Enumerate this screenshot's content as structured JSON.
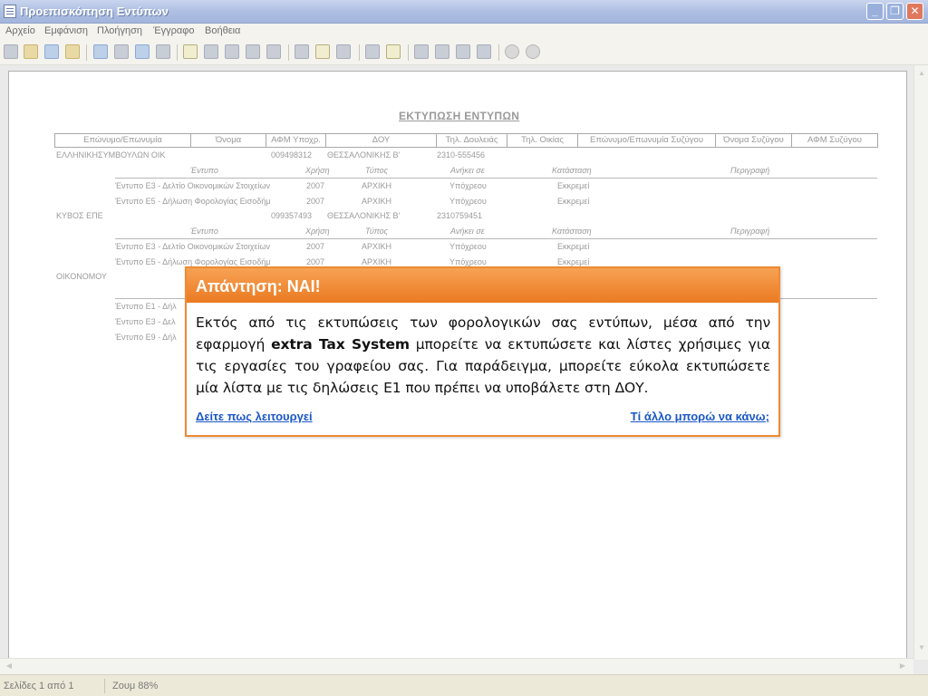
{
  "window": {
    "title": "Προεπισκόπηση Εντύπων"
  },
  "menu": [
    "Αρχείο",
    "Εμφάνιση",
    "Πλοήγηση",
    "Έγγραφο",
    "Βοήθεια"
  ],
  "report": {
    "title": "ΕΚΤΥΠΩΣΗ ΕΝΤΥΠΩΝ",
    "columns": [
      "Επώνυμο/Επωνυμία",
      "Όνομα",
      "ΑΦΜ Υποχρ.",
      "ΔΟΥ",
      "Τηλ. Δουλειάς",
      "Τηλ. Οικίας",
      "Επώνυμο/Επωνυμία Συζύγου",
      "Όνομα Συζύγου",
      "ΑΦΜ Συζύγου"
    ],
    "sub_columns": [
      "Έντυπο",
      "Χρήση",
      "Τύπος",
      "Ανήκει σε",
      "Κατάσταση",
      "Περιγραφή"
    ],
    "taxpayers": [
      {
        "name": "ΕΛΛΗΝΙΚΗΣΥΜΒΟΥΛΩΝ ΟΙΚ",
        "afm": "009498312",
        "doy": "ΘΕΣΣΑΛΟΝΙΚΗΣ Β'",
        "phone": "2310-555456",
        "forms": [
          {
            "form": "Έντυπο Ε3 - Δελτίο Οικονομικών Στοιχείων",
            "year": "2007",
            "type": "ΑΡΧΙΚΗ",
            "belongs": "Υπόχρεου",
            "status": "Εκκρεμεί"
          },
          {
            "form": "Έντυπο Ε5 - Δήλωση Φορολογίας Εισοδήμ",
            "year": "2007",
            "type": "ΑΡΧΙΚΗ",
            "belongs": "Υπόχρεου",
            "status": "Εκκρεμεί"
          }
        ]
      },
      {
        "name": "ΚΥΒΟΣ ΕΠΕ",
        "afm": "099357493",
        "doy": "ΘΕΣΣΑΛΟΝΙΚΗΣ Β'",
        "phone": "2310759451",
        "forms": [
          {
            "form": "Έντυπο Ε3 - Δελτίο Οικονομικών Στοιχείων",
            "year": "2007",
            "type": "ΑΡΧΙΚΗ",
            "belongs": "Υπόχρεου",
            "status": "Εκκρεμεί"
          },
          {
            "form": "Έντυπο Ε5 - Δήλωση Φορολογίας Εισοδήμ",
            "year": "2007",
            "type": "ΑΡΧΙΚΗ",
            "belongs": "Υπόχρεου",
            "status": "Εκκρεμεί"
          }
        ]
      },
      {
        "name": "ΟΙΚΟΝΟΜΟΥ",
        "forms_partial": [
          "Έντυπο Ε1 - Δήλ",
          "Έντυπο Ε3 - Δελ",
          "Έντυπο Ε9 - Δήλ"
        ]
      }
    ]
  },
  "status": {
    "pages": "Σελίδες 1 από 1",
    "zoom": "Ζουμ 88%"
  },
  "popup": {
    "title": "Απάντηση: ΝΑΙ!",
    "body_pre": "Εκτός από τις εκτυπώσεις των φορολογικών σας εντύπων, μέσα από την εφαρμογή ",
    "body_bold": "extra Tax System",
    "body_post": " μπορείτε να εκτυπώσετε και λίστες χρήσιμες για τις εργασίες του γραφείου σας. Για παράδειγμα, μπορείτε εύκολα εκτυπώσετε μία λίστα με τις δηλώσεις Ε1 που πρέπει να υποβάλετε στη ΔΟΥ.",
    "link_left": "Δείτε πως λειτουργεί",
    "link_right": "Τί άλλο μπορώ να κάνω;"
  },
  "colors": {
    "accent": "#ef8a33",
    "link": "#1a57c5"
  }
}
